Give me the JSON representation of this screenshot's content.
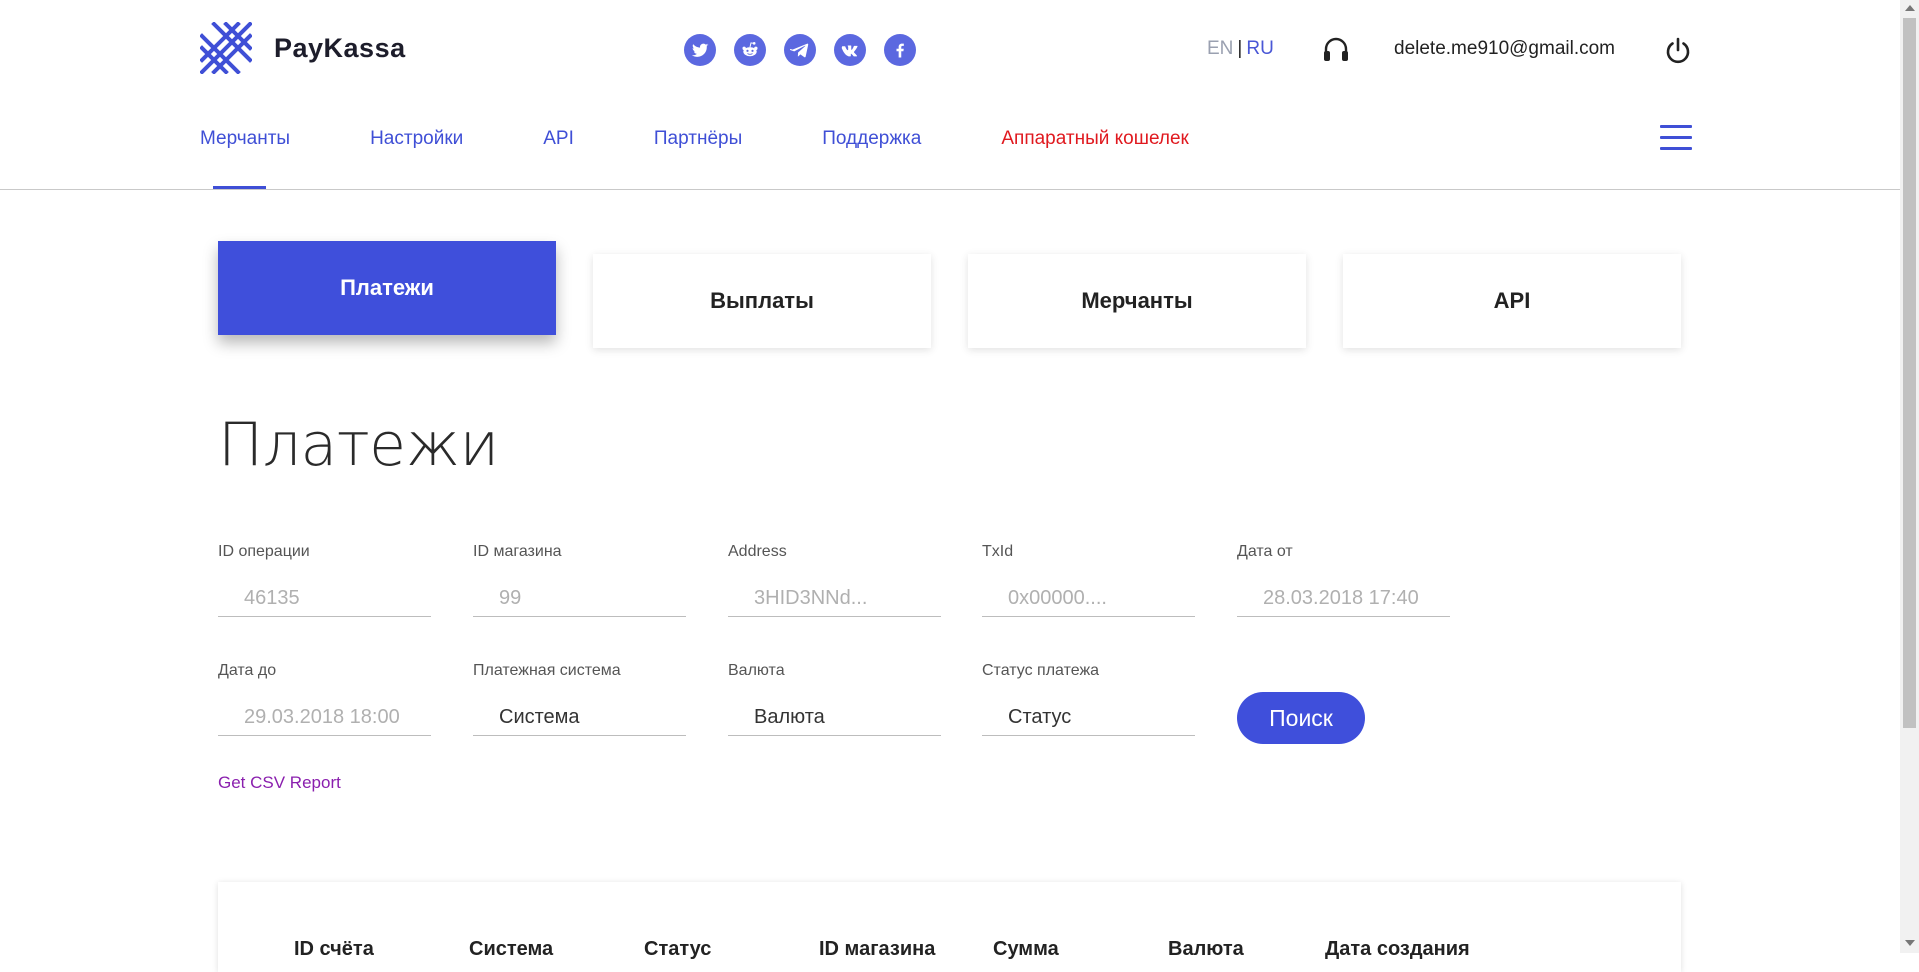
{
  "brand": {
    "name": "PayKassa"
  },
  "socials": [
    {
      "icon": "twitter-icon"
    },
    {
      "icon": "reddit-icon"
    },
    {
      "icon": "telegram-icon"
    },
    {
      "icon": "vk-icon"
    },
    {
      "icon": "facebook-icon"
    }
  ],
  "header": {
    "lang_en": "EN",
    "lang_sep": "|",
    "lang_ru": "RU",
    "email": "delete.me910@gmail.com"
  },
  "nav": {
    "items": [
      "Мерчанты",
      "Настройки",
      "API",
      "Партнёры",
      "Поддержка",
      "Аппаратный кошелек"
    ],
    "active": "Мерчанты"
  },
  "tiles": [
    "Платежи",
    "Выплаты",
    "Мерчанты",
    "API"
  ],
  "page_title": "Платежи",
  "filters": {
    "operation_id": {
      "label": "ID операции",
      "placeholder": "46135"
    },
    "shop_id": {
      "label": "ID магазина",
      "placeholder": "99"
    },
    "address": {
      "label": "Address",
      "placeholder": "3HID3NNd..."
    },
    "txid": {
      "label": "TxId",
      "placeholder": "0x00000...."
    },
    "date_from": {
      "label": "Дата от",
      "placeholder": "28.03.2018 17:40"
    },
    "date_to": {
      "label": "Дата до",
      "placeholder": "29.03.2018 18:00"
    },
    "payment_system": {
      "label": "Платежная система",
      "value": "Система"
    },
    "currency": {
      "label": "Валюта",
      "value": "Валюта"
    },
    "status": {
      "label": "Статус платежа",
      "value": "Статус"
    }
  },
  "search_label": "Поиск",
  "csv_link": "Get CSV Report",
  "table": {
    "headers": [
      "ID счёта",
      "Система",
      "Статус",
      "ID магазина",
      "Сумма",
      "Валюта",
      "Дата создания"
    ]
  },
  "colors": {
    "accent": "#3f4fdb",
    "danger": "#e0191f",
    "link_visited": "#8a1fae"
  }
}
